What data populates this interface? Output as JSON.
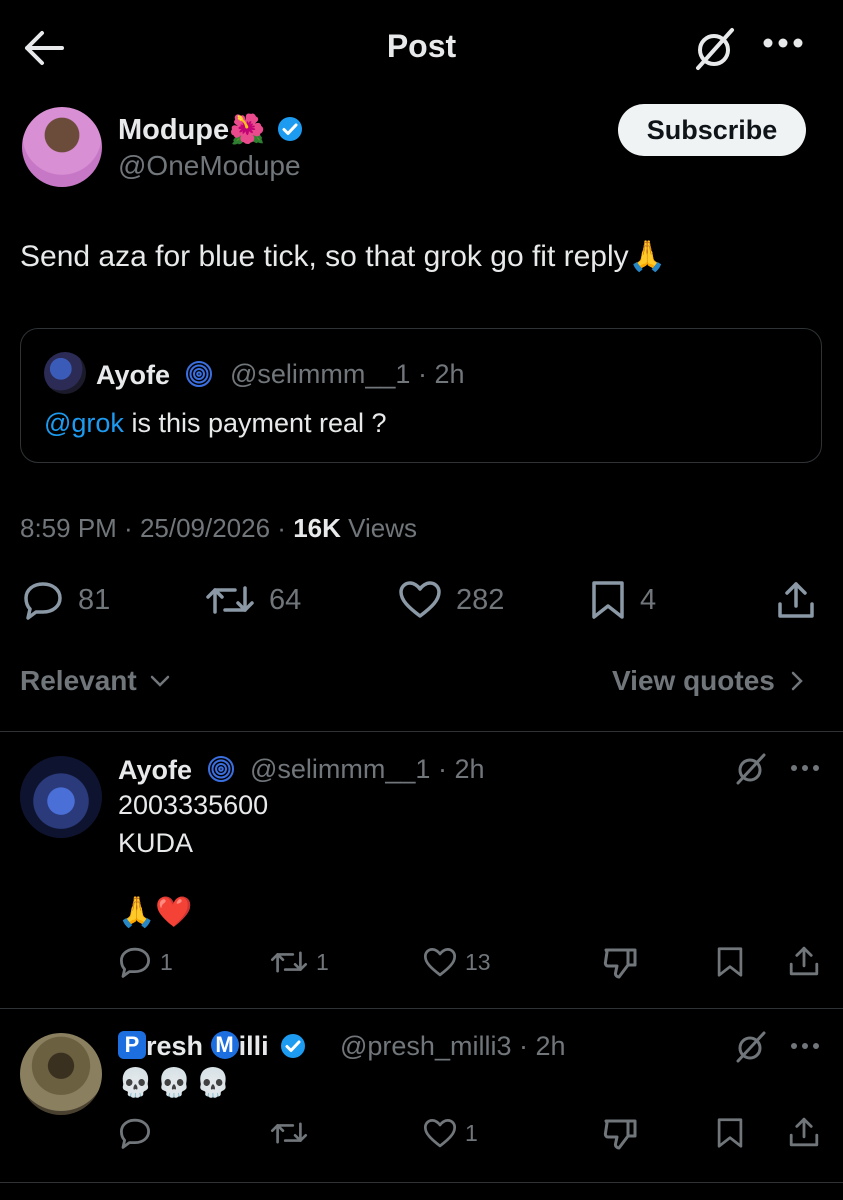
{
  "header": {
    "title": "Post"
  },
  "post": {
    "author_name": "Modupe",
    "author_emoji": "🌺",
    "author_handle": "@OneModupe",
    "subscribe_label": "Subscribe",
    "text": "Send aza for blue tick, so that grok go fit reply",
    "text_emoji": "🙏",
    "quote": {
      "name": "Ayofe",
      "handle_time": "@selimmm__1 · 2h",
      "mention": "@grok",
      "text": " is this payment real ?"
    },
    "time": "8:59 PM",
    "date": "25/09/2026",
    "views_count": "16K",
    "views_label": "Views",
    "stats": {
      "replies": "81",
      "reposts": "64",
      "likes": "282",
      "bookmarks": "4"
    }
  },
  "sort": {
    "relevant_label": "Relevant",
    "view_quotes_label": "View quotes"
  },
  "replies": [
    {
      "name": "Ayofe",
      "handle_time": "@selimmm__1 · 2h",
      "line1": "2003335600",
      "line2": "KUDA",
      "emojis": "🙏❤️",
      "stats": {
        "replies": "1",
        "reposts": "1",
        "likes": "13"
      }
    },
    {
      "name_p": "P",
      "name_part1": "resh",
      "name_m": "M",
      "name_part2": "illi",
      "handle_time": "@presh_milli3 · 2h",
      "emojis": "💀💀💀",
      "stats": {
        "replies": "",
        "reposts": "",
        "likes": "1"
      }
    }
  ],
  "colors": {
    "accent": "#1d9bf0",
    "verified": "#1d9bf0",
    "muted": "#71767b",
    "divider": "#2f3336"
  },
  "icons": [
    "back-arrow-icon",
    "grok-icon",
    "more-icon",
    "verified-icon",
    "fingerprint-icon",
    "reply-icon",
    "repost-icon",
    "like-icon",
    "bookmark-icon",
    "share-icon",
    "chevron-down-icon",
    "chevron-right-icon",
    "dislike-icon"
  ]
}
